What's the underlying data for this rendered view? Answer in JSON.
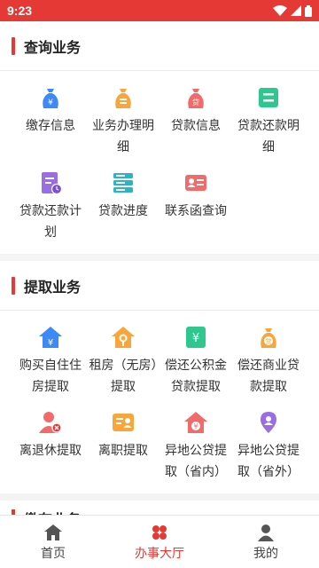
{
  "status_bar": {
    "time": "9:23",
    "background": "#e53935"
  },
  "sections": [
    {
      "title": "查询业务",
      "items": [
        {
          "label": "缴存信息",
          "icon": "money-bag-yen-icon",
          "color": "#3d8af7"
        },
        {
          "label": "业务办理明细",
          "icon": "money-bag-orange-icon",
          "color": "#f8a53c"
        },
        {
          "label": "贷款信息",
          "icon": "loan-bag-icon",
          "color": "#f26b6b"
        },
        {
          "label": "贷款还款明细",
          "icon": "repayment-list-icon",
          "color": "#2ec88e"
        },
        {
          "label": "贷款还款计划",
          "icon": "document-clock-icon",
          "color": "#9b6de3"
        },
        {
          "label": "贷款进度",
          "icon": "progress-list-icon",
          "color": "#2cb3c8"
        },
        {
          "label": "联系函查询",
          "icon": "contact-card-icon",
          "color": "#f26b6b"
        }
      ]
    },
    {
      "title": "提取业务",
      "items": [
        {
          "label": "购买自住住房提取",
          "icon": "house-yen-icon",
          "color": "#3d8af7"
        },
        {
          "label": "租房（无房）提取",
          "icon": "rent-house-key-icon",
          "color": "#f8a53c"
        },
        {
          "label": "偿还公积金贷款提取",
          "icon": "fund-repay-icon",
          "color": "#2ec88e"
        },
        {
          "label": "偿还商业贷款提取",
          "icon": "commercial-loan-bag-icon",
          "color": "#f8a53c"
        },
        {
          "label": "离退休提取",
          "icon": "retire-user-icon",
          "color": "#f26b6b"
        },
        {
          "label": "离职提取",
          "icon": "resign-card-icon",
          "color": "#f8a53c"
        },
        {
          "label": "异地公贷提取（省内）",
          "icon": "house-yen-red-icon",
          "color": "#f26b6b"
        },
        {
          "label": "异地公贷提取（省外）",
          "icon": "location-user-icon",
          "color": "#9b6de3"
        }
      ]
    }
  ],
  "peek_section": {
    "title": "缴存业务"
  },
  "tabs": [
    {
      "label": "首页",
      "icon": "home-icon"
    },
    {
      "label": "办事大厅",
      "icon": "clover-icon",
      "active": true
    },
    {
      "label": "我的",
      "icon": "user-icon"
    }
  ],
  "accent": "#e53935"
}
